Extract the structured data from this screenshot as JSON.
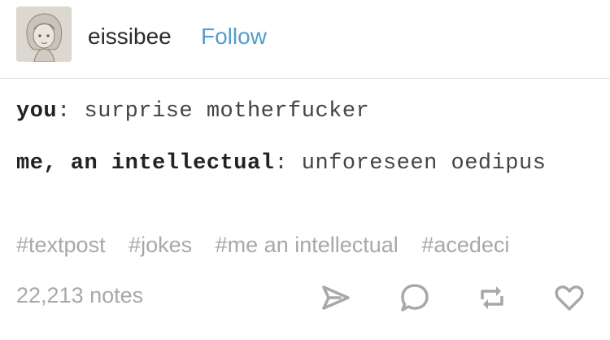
{
  "post": {
    "blog_name": "eissibee",
    "follow_label": "Follow",
    "lines": [
      {
        "speaker": "you",
        "separator": ":",
        "text": " surprise motherfucker"
      },
      {
        "speaker": "me, an intellectual",
        "separator": ":",
        "text": " unforeseen oedipus"
      }
    ],
    "tags": [
      "#textpost",
      "#jokes",
      "#me an intellectual",
      "#acedeci"
    ],
    "notes": "22,213 notes"
  },
  "icons": {
    "share": "share-icon",
    "reply": "reply-icon",
    "reblog": "reblog-icon",
    "like": "like-icon"
  },
  "colors": {
    "follow": "#529ecc",
    "muted": "#a8a8a8",
    "text": "#444444",
    "icon": "#a8a8a8"
  }
}
